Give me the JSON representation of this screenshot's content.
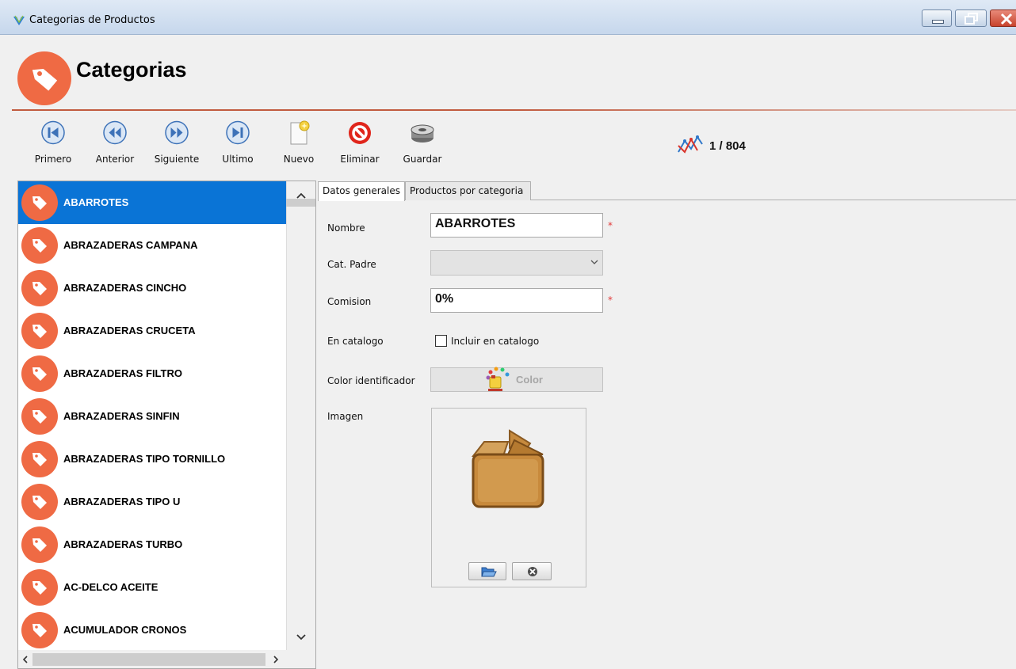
{
  "window": {
    "title": "Categorias de Productos"
  },
  "header": {
    "title": "Categorias"
  },
  "toolbar": {
    "primero": "Primero",
    "anterior": "Anterior",
    "siguiente": "Siguiente",
    "ultimo": "Ultimo",
    "nuevo": "Nuevo",
    "eliminar": "Eliminar",
    "guardar": "Guardar"
  },
  "record_counter": "1 / 804",
  "categories": {
    "selected_index": 0,
    "items": [
      "ABARROTES",
      "ABRAZADERAS CAMPANA",
      "ABRAZADERAS CINCHO",
      "ABRAZADERAS CRUCETA",
      "ABRAZADERAS FILTRO",
      "ABRAZADERAS SINFIN",
      "ABRAZADERAS TIPO TORNILLO",
      "ABRAZADERAS TIPO U",
      "ABRAZADERAS TURBO",
      "AC-DELCO ACEITE",
      "ACUMULADOR CRONOS"
    ]
  },
  "tabs": {
    "general": "Datos generales",
    "products": "Productos por categoria"
  },
  "form": {
    "nombre_label": "Nombre",
    "nombre_value": "ABARROTES",
    "required_mark": "*",
    "padre_label": "Cat. Padre",
    "padre_value": "",
    "comision_label": "Comision",
    "comision_value": "0%",
    "catalogo_label": "En catalogo",
    "catalogo_checkbox_label": "Incluir en catalogo",
    "catalogo_checked": false,
    "color_label": "Color identificador",
    "color_button": "Color",
    "imagen_label": "Imagen"
  },
  "colors": {
    "accent_orange": "#ef6a44",
    "selection_blue": "#0a74d6",
    "required_red": "#e23b3b"
  },
  "icons": {
    "app": "app-icon",
    "logo": "tag-icon",
    "primero": "first-record-icon",
    "anterior": "previous-record-icon",
    "siguiente": "next-record-icon",
    "ultimo": "last-record-icon",
    "nuevo": "new-document-icon",
    "eliminar": "delete-icon",
    "guardar": "save-disk-icon",
    "record": "record-chart-icon",
    "image_placeholder": "cardboard-box-icon",
    "open_image": "open-folder-icon",
    "clear_image": "clear-icon"
  }
}
